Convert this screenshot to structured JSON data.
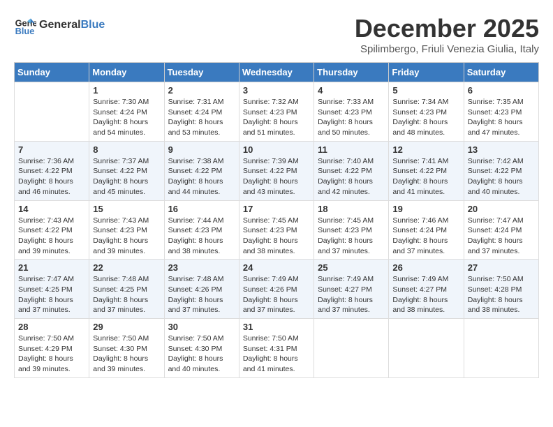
{
  "header": {
    "logo_text_general": "General",
    "logo_text_blue": "Blue",
    "month_title": "December 2025",
    "subtitle": "Spilimbergo, Friuli Venezia Giulia, Italy"
  },
  "weekdays": [
    "Sunday",
    "Monday",
    "Tuesday",
    "Wednesday",
    "Thursday",
    "Friday",
    "Saturday"
  ],
  "weeks": [
    [
      {
        "day": "",
        "info": ""
      },
      {
        "day": "1",
        "info": "Sunrise: 7:30 AM\nSunset: 4:24 PM\nDaylight: 8 hours\nand 54 minutes."
      },
      {
        "day": "2",
        "info": "Sunrise: 7:31 AM\nSunset: 4:24 PM\nDaylight: 8 hours\nand 53 minutes."
      },
      {
        "day": "3",
        "info": "Sunrise: 7:32 AM\nSunset: 4:23 PM\nDaylight: 8 hours\nand 51 minutes."
      },
      {
        "day": "4",
        "info": "Sunrise: 7:33 AM\nSunset: 4:23 PM\nDaylight: 8 hours\nand 50 minutes."
      },
      {
        "day": "5",
        "info": "Sunrise: 7:34 AM\nSunset: 4:23 PM\nDaylight: 8 hours\nand 48 minutes."
      },
      {
        "day": "6",
        "info": "Sunrise: 7:35 AM\nSunset: 4:23 PM\nDaylight: 8 hours\nand 47 minutes."
      }
    ],
    [
      {
        "day": "7",
        "info": "Sunrise: 7:36 AM\nSunset: 4:22 PM\nDaylight: 8 hours\nand 46 minutes."
      },
      {
        "day": "8",
        "info": "Sunrise: 7:37 AM\nSunset: 4:22 PM\nDaylight: 8 hours\nand 45 minutes."
      },
      {
        "day": "9",
        "info": "Sunrise: 7:38 AM\nSunset: 4:22 PM\nDaylight: 8 hours\nand 44 minutes."
      },
      {
        "day": "10",
        "info": "Sunrise: 7:39 AM\nSunset: 4:22 PM\nDaylight: 8 hours\nand 43 minutes."
      },
      {
        "day": "11",
        "info": "Sunrise: 7:40 AM\nSunset: 4:22 PM\nDaylight: 8 hours\nand 42 minutes."
      },
      {
        "day": "12",
        "info": "Sunrise: 7:41 AM\nSunset: 4:22 PM\nDaylight: 8 hours\nand 41 minutes."
      },
      {
        "day": "13",
        "info": "Sunrise: 7:42 AM\nSunset: 4:22 PM\nDaylight: 8 hours\nand 40 minutes."
      }
    ],
    [
      {
        "day": "14",
        "info": "Sunrise: 7:43 AM\nSunset: 4:22 PM\nDaylight: 8 hours\nand 39 minutes."
      },
      {
        "day": "15",
        "info": "Sunrise: 7:43 AM\nSunset: 4:23 PM\nDaylight: 8 hours\nand 39 minutes."
      },
      {
        "day": "16",
        "info": "Sunrise: 7:44 AM\nSunset: 4:23 PM\nDaylight: 8 hours\nand 38 minutes."
      },
      {
        "day": "17",
        "info": "Sunrise: 7:45 AM\nSunset: 4:23 PM\nDaylight: 8 hours\nand 38 minutes."
      },
      {
        "day": "18",
        "info": "Sunrise: 7:45 AM\nSunset: 4:23 PM\nDaylight: 8 hours\nand 37 minutes."
      },
      {
        "day": "19",
        "info": "Sunrise: 7:46 AM\nSunset: 4:24 PM\nDaylight: 8 hours\nand 37 minutes."
      },
      {
        "day": "20",
        "info": "Sunrise: 7:47 AM\nSunset: 4:24 PM\nDaylight: 8 hours\nand 37 minutes."
      }
    ],
    [
      {
        "day": "21",
        "info": "Sunrise: 7:47 AM\nSunset: 4:25 PM\nDaylight: 8 hours\nand 37 minutes."
      },
      {
        "day": "22",
        "info": "Sunrise: 7:48 AM\nSunset: 4:25 PM\nDaylight: 8 hours\nand 37 minutes."
      },
      {
        "day": "23",
        "info": "Sunrise: 7:48 AM\nSunset: 4:26 PM\nDaylight: 8 hours\nand 37 minutes."
      },
      {
        "day": "24",
        "info": "Sunrise: 7:49 AM\nSunset: 4:26 PM\nDaylight: 8 hours\nand 37 minutes."
      },
      {
        "day": "25",
        "info": "Sunrise: 7:49 AM\nSunset: 4:27 PM\nDaylight: 8 hours\nand 37 minutes."
      },
      {
        "day": "26",
        "info": "Sunrise: 7:49 AM\nSunset: 4:27 PM\nDaylight: 8 hours\nand 38 minutes."
      },
      {
        "day": "27",
        "info": "Sunrise: 7:50 AM\nSunset: 4:28 PM\nDaylight: 8 hours\nand 38 minutes."
      }
    ],
    [
      {
        "day": "28",
        "info": "Sunrise: 7:50 AM\nSunset: 4:29 PM\nDaylight: 8 hours\nand 39 minutes."
      },
      {
        "day": "29",
        "info": "Sunrise: 7:50 AM\nSunset: 4:30 PM\nDaylight: 8 hours\nand 39 minutes."
      },
      {
        "day": "30",
        "info": "Sunrise: 7:50 AM\nSunset: 4:30 PM\nDaylight: 8 hours\nand 40 minutes."
      },
      {
        "day": "31",
        "info": "Sunrise: 7:50 AM\nSunset: 4:31 PM\nDaylight: 8 hours\nand 41 minutes."
      },
      {
        "day": "",
        "info": ""
      },
      {
        "day": "",
        "info": ""
      },
      {
        "day": "",
        "info": ""
      }
    ]
  ]
}
